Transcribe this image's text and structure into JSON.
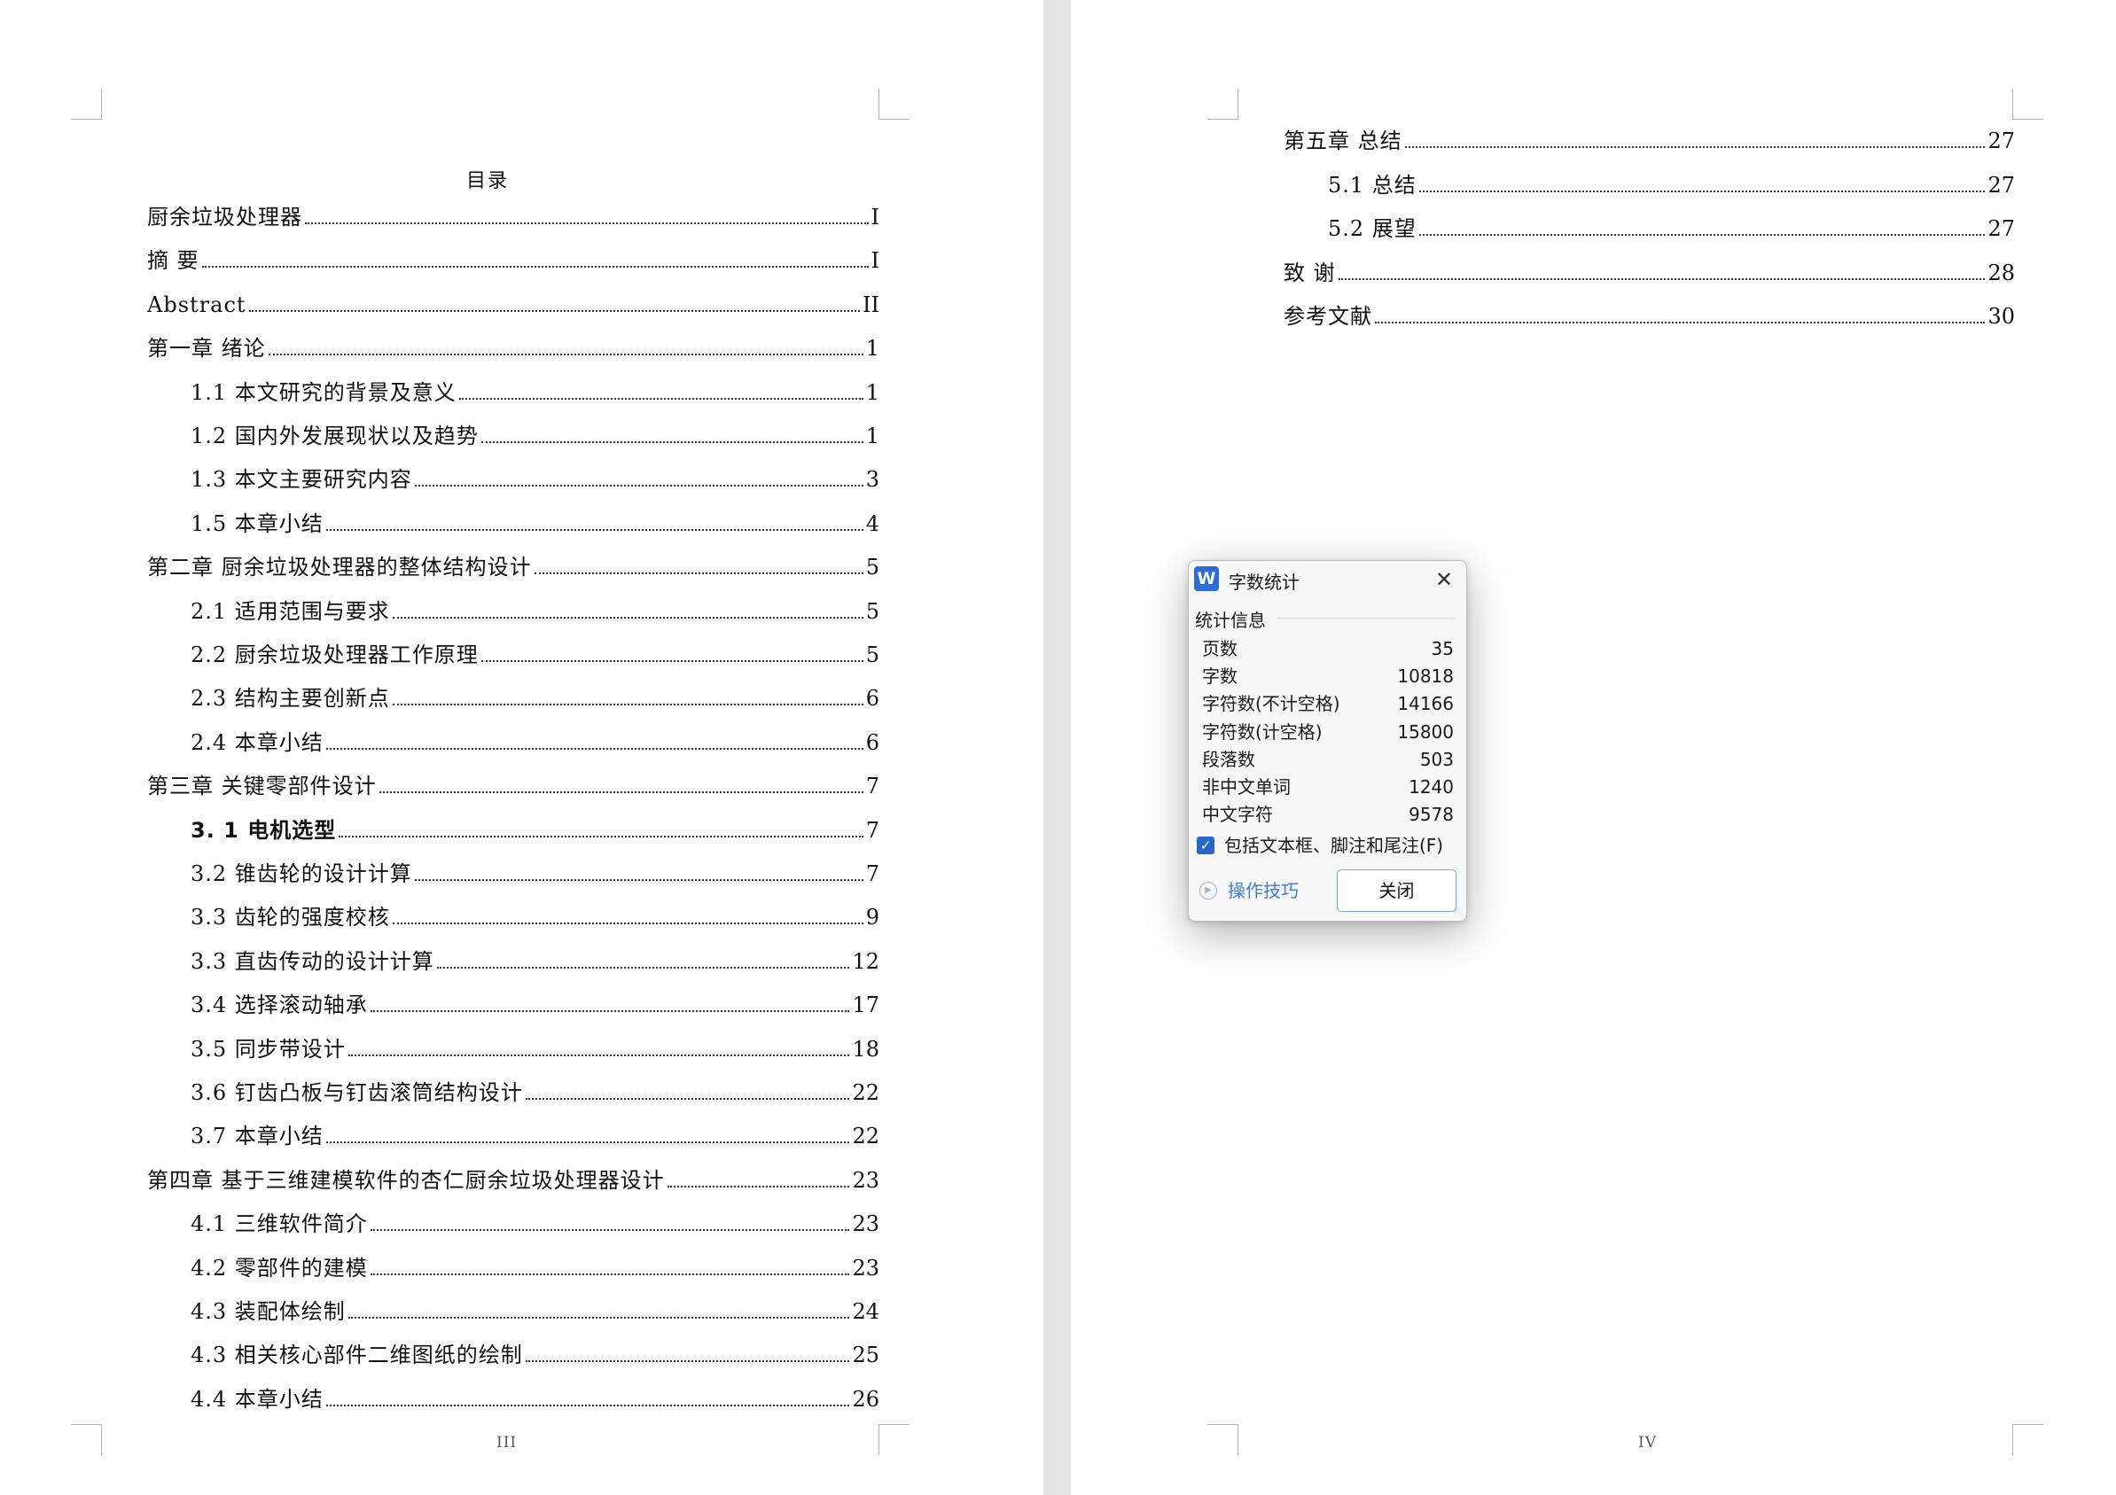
{
  "left_page": {
    "toc_title": "目录",
    "entries": [
      {
        "title": "厨余垃圾处理器",
        "page": "I",
        "bold": false
      },
      {
        "title": "摘  要",
        "page": "I",
        "bold": false
      },
      {
        "title": "Abstract",
        "page": "II",
        "bold": false
      },
      {
        "title": "第一章  绪论",
        "page": "1",
        "bold": false
      },
      {
        "title": "1.1  本文研究的背景及意义",
        "page": "1",
        "bold": false
      },
      {
        "title": "1.2  国内外发展现状以及趋势",
        "page": "1",
        "bold": false
      },
      {
        "title": "1.3  本文主要研究内容",
        "page": "3",
        "bold": false
      },
      {
        "title": "1.5  本章小结",
        "page": "4",
        "bold": false
      },
      {
        "title": "第二章  厨余垃圾处理器的整体结构设计",
        "page": "5",
        "bold": false
      },
      {
        "title": "2.1  适用范围与要求",
        "page": "5",
        "bold": false
      },
      {
        "title": "2.2  厨余垃圾处理器工作原理",
        "page": "5",
        "bold": false
      },
      {
        "title": "2.3  结构主要创新点",
        "page": "6",
        "bold": false
      },
      {
        "title": "2.4  本章小结",
        "page": "6",
        "bold": false
      },
      {
        "title": "第三章  关键零部件设计",
        "page": "7",
        "bold": false
      },
      {
        "title": "3. 1  电机选型",
        "page": "7",
        "bold": true
      },
      {
        "title": "3.2  锥齿轮的设计计算",
        "page": "7",
        "bold": false
      },
      {
        "title": "3.3  齿轮的强度校核",
        "page": "9",
        "bold": false
      },
      {
        "title": "3.3  直齿传动的设计计算",
        "page": "12",
        "bold": false
      },
      {
        "title": "3.4  选择滚动轴承",
        "page": "17",
        "bold": false
      },
      {
        "title": "3.5  同步带设计",
        "page": "18",
        "bold": false
      },
      {
        "title": "3.6  钉齿凸板与钉齿滚筒结构设计",
        "page": "22",
        "bold": false
      },
      {
        "title": "3.7  本章小结",
        "page": "22",
        "bold": false
      },
      {
        "title": "第四章  基于三维建模软件的杏仁厨余垃圾处理器设计",
        "page": "23",
        "bold": false
      },
      {
        "title": "4.1  三维软件简介",
        "page": "23",
        "bold": false
      },
      {
        "title": "4.2  零部件的建模",
        "page": "23",
        "bold": false
      },
      {
        "title": "4.3  装配体绘制",
        "page": "24",
        "bold": false
      },
      {
        "title": "4.3  相关核心部件二维图纸的绘制",
        "page": "25",
        "bold": false
      },
      {
        "title": "4.4  本章小结",
        "page": "26",
        "bold": false
      }
    ],
    "page_number": "III"
  },
  "right_page": {
    "entries": [
      {
        "title": "第五章  总结",
        "page": "27"
      },
      {
        "title": "5.1  总结",
        "page": "27"
      },
      {
        "title": "5.2  展望",
        "page": "27"
      },
      {
        "title": "致  谢",
        "page": "28"
      },
      {
        "title": "参考文献",
        "page": "30"
      }
    ],
    "page_number": "IV"
  },
  "dialog": {
    "icon_letter": "W",
    "title": "字数统计",
    "close_glyph": "✕",
    "section_label": "统计信息",
    "stats": [
      {
        "label": "页数",
        "value": "35"
      },
      {
        "label": "字数",
        "value": "10818"
      },
      {
        "label": "字符数(不计空格)",
        "value": "14166"
      },
      {
        "label": "字符数(计空格)",
        "value": "15800"
      },
      {
        "label": "段落数",
        "value": "503"
      },
      {
        "label": "非中文单词",
        "value": "1240"
      },
      {
        "label": "中文字符",
        "value": "9578"
      }
    ],
    "checkbox_label": "包括文本框、脚注和尾注(F)",
    "checkbox_checked": true,
    "tips_label": "操作技巧",
    "close_button_label": "关闭"
  },
  "colors": {
    "gutter": "#e4e4e4",
    "accent_blue": "#2667c9",
    "link_blue": "#3d7fd4"
  }
}
